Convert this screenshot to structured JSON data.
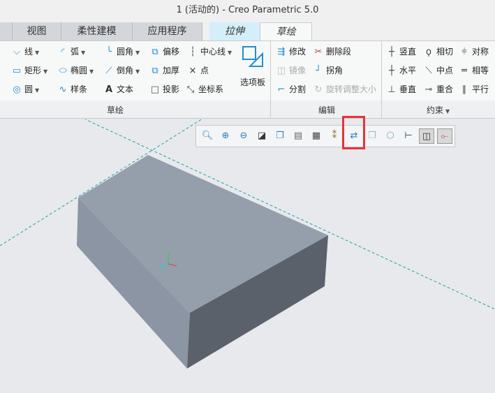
{
  "window": {
    "title": "1 (活动的) - Creo Parametric 5.0"
  },
  "tabs": [
    "视图",
    "柔性建模",
    "应用程序",
    "拉伸",
    "草绘"
  ],
  "groups": {
    "sketch": "草绘",
    "edit": "编辑",
    "constrain": "约束"
  },
  "sketch_items": [
    {
      "label": "线",
      "icon": "line-icon"
    },
    {
      "label": "弧",
      "icon": "arc-icon"
    },
    {
      "label": "圆角",
      "icon": "fillet-icon"
    },
    {
      "label": "偏移",
      "icon": "offset-icon"
    },
    {
      "label": "中心线",
      "icon": "centerline-icon"
    },
    {
      "label": "矩形",
      "icon": "rectangle-icon"
    },
    {
      "label": "椭圆",
      "icon": "ellipse-icon"
    },
    {
      "label": "倒角",
      "icon": "chamfer-icon"
    },
    {
      "label": "加厚",
      "icon": "thicken-icon"
    },
    {
      "label": "点",
      "icon": "point-icon"
    },
    {
      "label": "圆",
      "icon": "circle-icon"
    },
    {
      "label": "样条",
      "icon": "spline-icon"
    },
    {
      "label": "文本",
      "icon": "text-icon"
    },
    {
      "label": "投影",
      "icon": "project-icon"
    },
    {
      "label": "坐标系",
      "icon": "coordinate-system-icon"
    }
  ],
  "palette": "选项板",
  "edit_items": [
    {
      "label": "修改"
    },
    {
      "label": "删除段"
    },
    {
      "label": "镜像"
    },
    {
      "label": "拐角"
    },
    {
      "label": "分割"
    },
    {
      "label": "旋转调整大小"
    }
  ],
  "constraint_items": [
    {
      "label": "竖直"
    },
    {
      "label": "相切"
    },
    {
      "label": "对称"
    },
    {
      "label": "水平"
    },
    {
      "label": "中点"
    },
    {
      "label": "相等"
    },
    {
      "label": "垂直"
    },
    {
      "label": "重合"
    },
    {
      "label": "平行"
    }
  ],
  "view_toolbar": [
    "refit",
    "zoom-in",
    "zoom-out",
    "repaint",
    "display-style",
    "saved-orientations",
    "view-manager",
    "datum-display",
    "sketch-view",
    "shading",
    "wireframe",
    "annotation-display",
    "sketch-display",
    "constraint-display"
  ],
  "colors": {
    "highlight": "#e8323a",
    "accent": "#1f8fd0",
    "model_top": "#959fac",
    "model_right": "#5b616b"
  }
}
